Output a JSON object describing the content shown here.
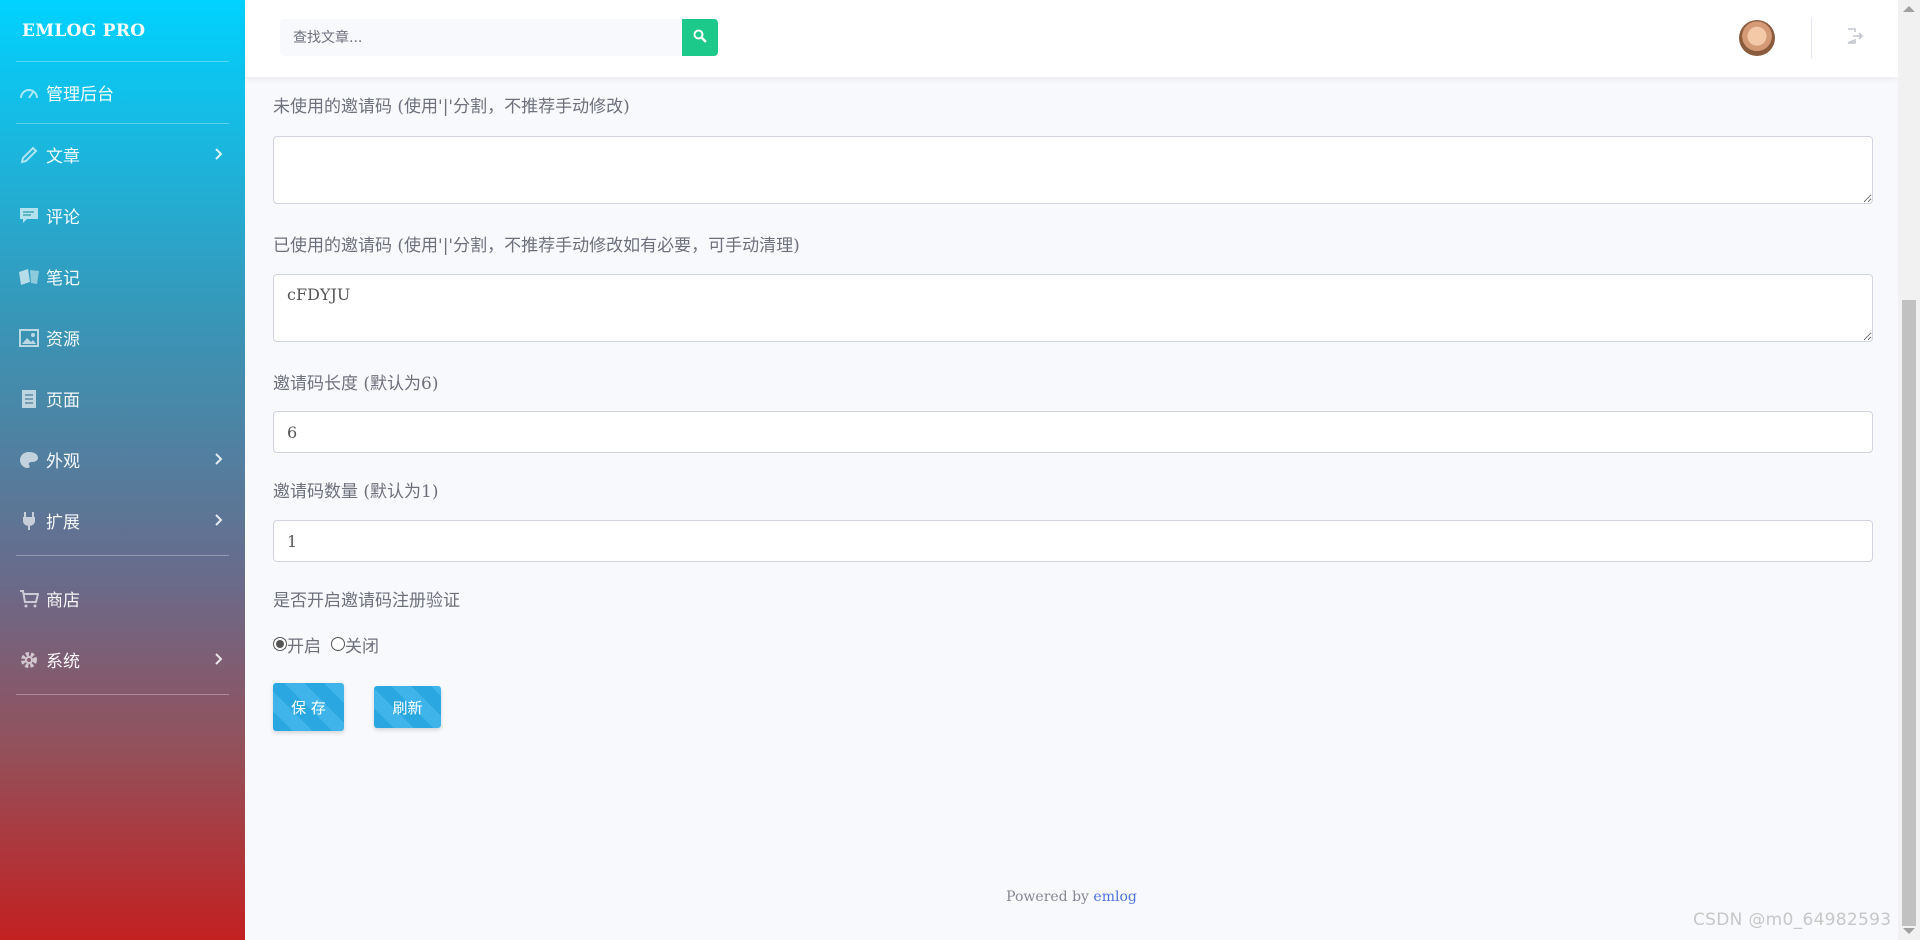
{
  "sidebar": {
    "brand": "EMLOG PRO",
    "items": [
      {
        "label": "管理后台",
        "icon": "dashboard-icon",
        "has_children": false
      },
      {
        "label": "文章",
        "icon": "pencil-icon",
        "has_children": true
      },
      {
        "label": "评论",
        "icon": "comment-icon",
        "has_children": false
      },
      {
        "label": "笔记",
        "icon": "notes-icon",
        "has_children": false
      },
      {
        "label": "资源",
        "icon": "image-icon",
        "has_children": false
      },
      {
        "label": "页面",
        "icon": "page-icon",
        "has_children": false
      },
      {
        "label": "外观",
        "icon": "palette-icon",
        "has_children": true
      },
      {
        "label": "扩展",
        "icon": "plug-icon",
        "has_children": true
      },
      {
        "label": "商店",
        "icon": "cart-icon",
        "has_children": false
      },
      {
        "label": "系统",
        "icon": "gear-icon",
        "has_children": true
      }
    ]
  },
  "topbar": {
    "search_placeholder": "查找文章...",
    "search_icon": "search-icon",
    "logout_icon": "logout-icon"
  },
  "form": {
    "unused_label": "未使用的邀请码 (使用'|'分割，不推荐手动修改)",
    "unused_value": "",
    "used_label": "已使用的邀请码 (使用'|'分割，不推荐手动修改如有必要，可手动清理)",
    "used_value": "cFDYJU",
    "length_label": "邀请码长度 (默认为6)",
    "length_value": "6",
    "count_label": "邀请码数量 (默认为1)",
    "count_value": "1",
    "enable_label": "是否开启邀请码注册验证",
    "radio_on": "开启",
    "radio_off": "关闭",
    "enabled": true,
    "save_label": "保 存",
    "refresh_label": "刷新"
  },
  "footer": {
    "powered_by": "Powered by",
    "link": "emlog"
  },
  "watermark": "CSDN @m0_64982593",
  "colors": {
    "accent_green": "#1cc88a",
    "button_blue": "#2aa7e0",
    "sidebar_top": "#00d2ff",
    "sidebar_bottom": "#c32020"
  }
}
